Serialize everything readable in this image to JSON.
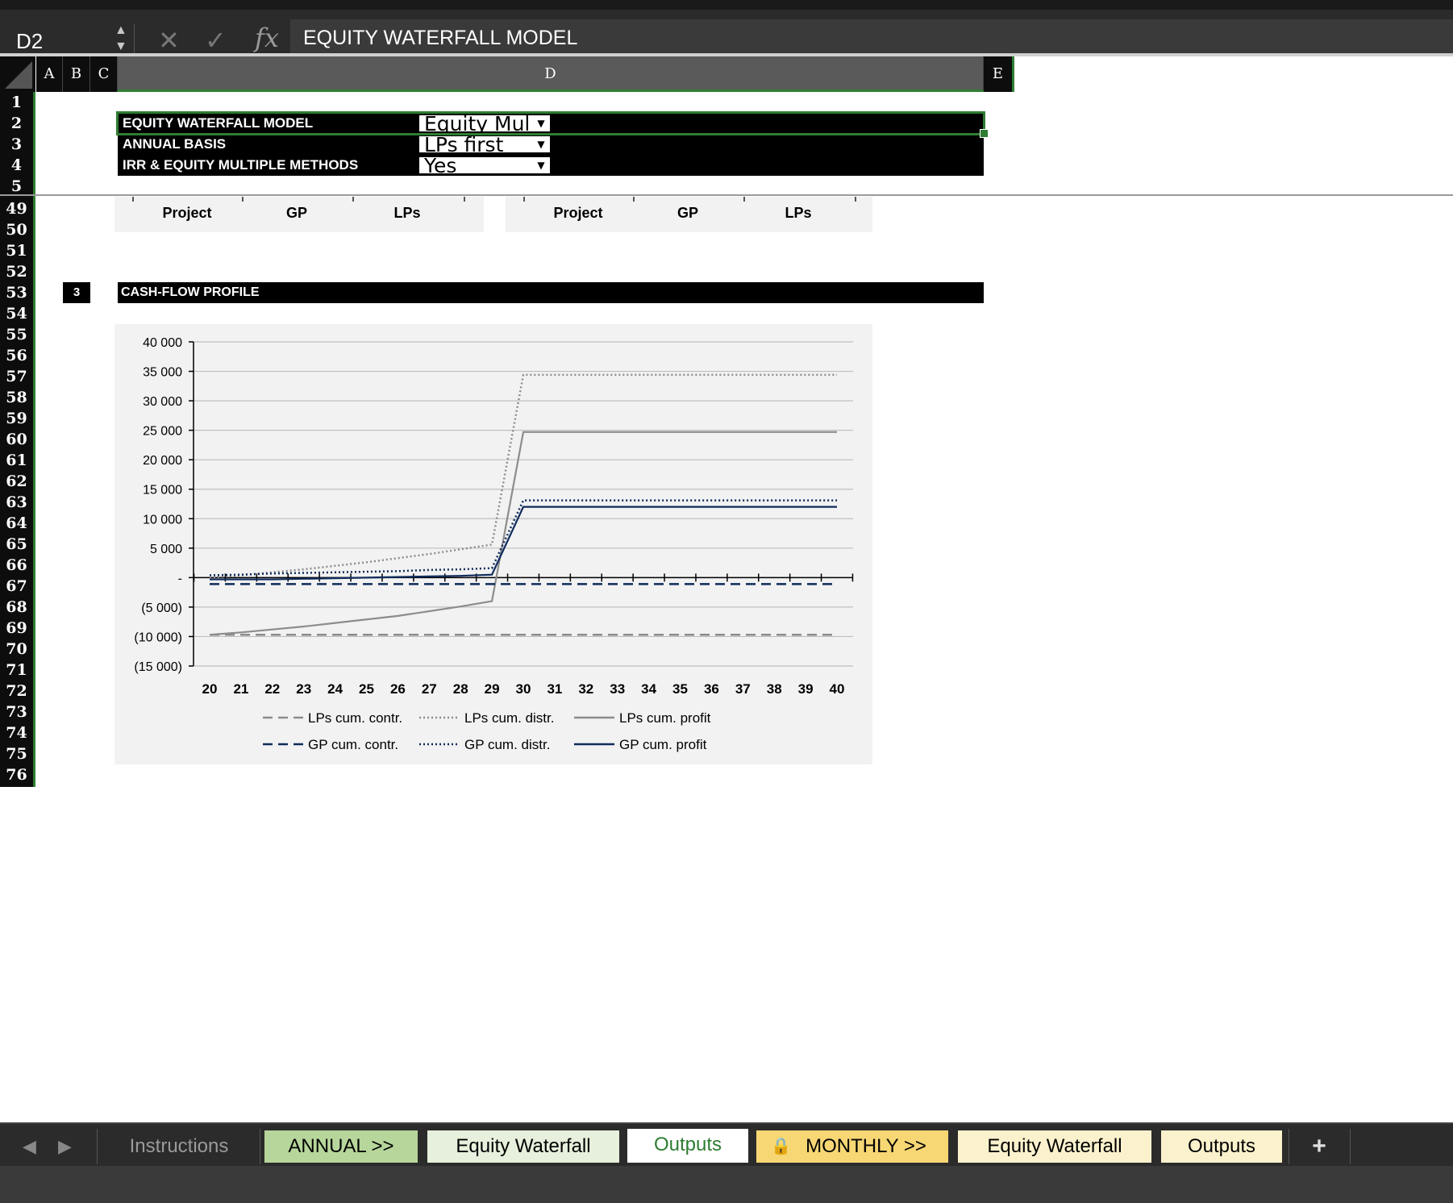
{
  "formula_bar": {
    "cell_ref": "D2",
    "cancel_icon": "close-icon",
    "confirm_icon": "check-icon",
    "fx_label": "fx",
    "content": "EQUITY WATERFALL MODEL"
  },
  "columns": [
    "A",
    "B",
    "C",
    "D",
    "E"
  ],
  "rows": [
    "1",
    "2",
    "3",
    "4",
    "5",
    "49",
    "50",
    "51",
    "52",
    "53",
    "54",
    "55",
    "56",
    "57",
    "58",
    "59",
    "60",
    "61",
    "62",
    "63",
    "64",
    "65",
    "66",
    "67",
    "68",
    "69",
    "70",
    "71",
    "72",
    "73",
    "74",
    "75",
    "76"
  ],
  "header_block": {
    "title": "EQUITY WATERFALL MODEL",
    "title_dropdown": "Equity Mul",
    "basis_label": "ANNUAL BASIS",
    "basis_dropdown": "LPs first",
    "methods_label": "IRR & EQUITY MULTIPLE METHODS",
    "methods_dropdown": "Yes"
  },
  "table_headers": {
    "left": [
      "Project",
      "GP",
      "LPs"
    ],
    "right": [
      "Project",
      "GP",
      "LPs"
    ]
  },
  "section": {
    "number": "3",
    "title": "CASH-FLOW PROFILE"
  },
  "chart_data": {
    "type": "line",
    "x": [
      20,
      21,
      22,
      23,
      24,
      25,
      26,
      27,
      28,
      29,
      30,
      31,
      32,
      33,
      34,
      35,
      36,
      37,
      38,
      39,
      40
    ],
    "y_ticks": [
      "40 000",
      "35 000",
      "30 000",
      "25 000",
      "20 000",
      "15 000",
      "10 000",
      "5 000",
      "-",
      "(5 000)",
      "(10 000)",
      "(15 000)"
    ],
    "ylim": [
      -15000,
      40000
    ],
    "grid": true,
    "legend_position": "bottom",
    "series": [
      {
        "name": "LPs cum. contr.",
        "color": "#8c8c8c",
        "style": "dashed",
        "values": [
          -9700,
          -9700,
          -9700,
          -9700,
          -9700,
          -9700,
          -9700,
          -9700,
          -9700,
          -9700,
          -9700,
          -9700,
          -9700,
          -9700,
          -9700,
          -9700,
          -9700,
          -9700,
          -9700,
          -9700,
          -9700
        ]
      },
      {
        "name": "LPs cum. distr.",
        "color": "#8c8c8c",
        "style": "dotted",
        "values": [
          0,
          400,
          900,
          1400,
          2000,
          2600,
          3300,
          4000,
          4800,
          5600,
          34400,
          34400,
          34400,
          34400,
          34400,
          34400,
          34400,
          34400,
          34400,
          34400,
          34400
        ]
      },
      {
        "name": "LPs cum. profit",
        "color": "#8c8c8c",
        "style": "solid",
        "values": [
          -9700,
          -9300,
          -8800,
          -8300,
          -7700,
          -7100,
          -6500,
          -5700,
          -4900,
          -4000,
          24700,
          24700,
          24700,
          24700,
          24700,
          24700,
          24700,
          24700,
          24700,
          24700,
          24700
        ]
      },
      {
        "name": "GP cum. contr.",
        "color": "#0f2b5b",
        "style": "dashed",
        "values": [
          -1100,
          -1100,
          -1100,
          -1100,
          -1100,
          -1100,
          -1100,
          -1100,
          -1100,
          -1100,
          -1100,
          -1100,
          -1100,
          -1100,
          -1100,
          -1100,
          -1100,
          -1100,
          -1100,
          -1100,
          -1100
        ]
      },
      {
        "name": "GP cum. distr.",
        "color": "#0f2b5b",
        "style": "dotted",
        "values": [
          400,
          500,
          700,
          800,
          900,
          1000,
          1100,
          1300,
          1400,
          1600,
          13100,
          13100,
          13100,
          13100,
          13100,
          13100,
          13100,
          13100,
          13100,
          13100,
          13100
        ]
      },
      {
        "name": "GP cum. profit",
        "color": "#0f2b5b",
        "style": "solid",
        "values": [
          -300,
          -300,
          -300,
          -200,
          -100,
          0,
          100,
          200,
          300,
          500,
          12000,
          12000,
          12000,
          12000,
          12000,
          12000,
          12000,
          12000,
          12000,
          12000,
          12000
        ]
      }
    ]
  },
  "tabs": {
    "nav_prev_icon": "chevron-left-icon",
    "nav_next_icon": "chevron-right-icon",
    "items": [
      {
        "label": "Instructions",
        "active": false
      },
      {
        "label": "ANNUAL >>",
        "active": false
      },
      {
        "label": "Equity Waterfall",
        "active": false
      },
      {
        "label": "Outputs",
        "active": true
      },
      {
        "label": "MONTHLY >>",
        "active": false,
        "locked": true
      },
      {
        "label": "Equity Waterfall",
        "active": false
      },
      {
        "label": "Outputs",
        "active": false
      }
    ],
    "add_label": "+",
    "colors": {
      "annual": "#b7d69b",
      "annual_children": "#e6f0dc",
      "monthly": "#f7d774",
      "monthly_children": "#fbf2cd",
      "active_text": "#2e7d32"
    }
  }
}
